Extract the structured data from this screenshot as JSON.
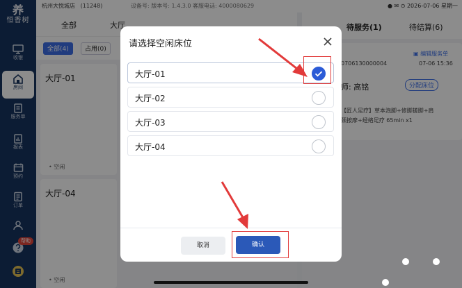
{
  "sidebar": {
    "logo_mark": "养",
    "logo_text": "恒香树",
    "items": [
      {
        "label": "收银",
        "icon": "monitor-icon"
      },
      {
        "label": "房间",
        "icon": "home-icon"
      },
      {
        "label": "服务单",
        "icon": "clipboard-icon"
      },
      {
        "label": "报表",
        "icon": "chart-icon"
      },
      {
        "label": "预约",
        "icon": "calendar-icon"
      },
      {
        "label": "订单",
        "icon": "document-icon"
      },
      {
        "label": "",
        "icon": "users-icon"
      },
      {
        "label": "",
        "icon": "help-icon"
      },
      {
        "label": "",
        "icon": "user-avatar-icon"
      }
    ],
    "active_item": "房间",
    "help_badge": "帮助"
  },
  "statusbar": {
    "shop": "杭州大悦城店",
    "shop_code": "(11248)",
    "meta": "设备号:  版本号: 1.4.3.0  客服电话: 4000080629",
    "datetime": "2026-07-06 星期一"
  },
  "main": {
    "tabs": [
      "全部",
      "大厅"
    ],
    "filters": [
      "全部(4)",
      "占用(0)"
    ],
    "rooms": [
      {
        "name": "大厅-01",
        "status": "空闲"
      },
      {
        "name": "大厅-04",
        "status": "空闲"
      }
    ]
  },
  "right_panel": {
    "tabs": [
      "待服务(1)",
      "待结算(6)"
    ],
    "edit_label": "编辑服务单",
    "order_no": "0706130000004",
    "order_date": "07-06 15:36",
    "therapist_label": "师:",
    "therapist": "高铭",
    "assign_btn": "分配床位",
    "service_line1": "【匠人足疗】草本泡脚+修脚搓脚+肩",
    "service_line2": "颈按摩+经络足疗 65min x1"
  },
  "modal": {
    "title": "请选择空闲床位",
    "beds": [
      {
        "name": "大厅-01",
        "selected": true
      },
      {
        "name": "大厅-02",
        "selected": false
      },
      {
        "name": "大厅-03",
        "selected": false
      },
      {
        "name": "大厅-04",
        "selected": false
      }
    ],
    "cancel_label": "取消",
    "confirm_label": "确认"
  },
  "colors": {
    "sidebar": "#17345f",
    "accent": "#2b5bd7",
    "annotation": "#e23a3a"
  }
}
